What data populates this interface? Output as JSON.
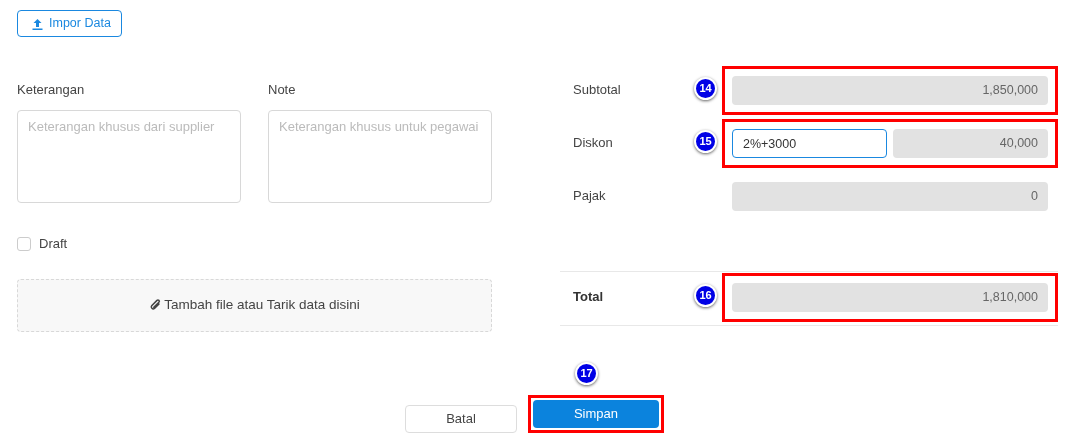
{
  "import_button": {
    "label": "Impor Data"
  },
  "notes": [
    {
      "label": "Keterangan",
      "placeholder": "Keterangan khusus dari supplier"
    },
    {
      "label": "Note",
      "placeholder": "Keterangan khusus untuk pegawai"
    }
  ],
  "draft": {
    "label": "Draft",
    "checked": false
  },
  "dropzone": {
    "label": "Tambah file atau Tarik data disini"
  },
  "summary": [
    {
      "kind": "readonly",
      "label": "Subtotal",
      "value": "1,850,000",
      "marker": "14"
    },
    {
      "kind": "discount",
      "label": "Diskon",
      "input": "2%+3000",
      "focused": true,
      "value": "40,000",
      "marker": "15"
    },
    {
      "kind": "readonly",
      "label": "Pajak",
      "value": "0"
    }
  ],
  "total": {
    "label": "Total",
    "value": "1,810,000",
    "marker": "16"
  },
  "buttons": [
    {
      "kind": "secondary",
      "label": "Batal"
    },
    {
      "kind": "primary",
      "label": "Simpan",
      "marker": "17"
    }
  ]
}
